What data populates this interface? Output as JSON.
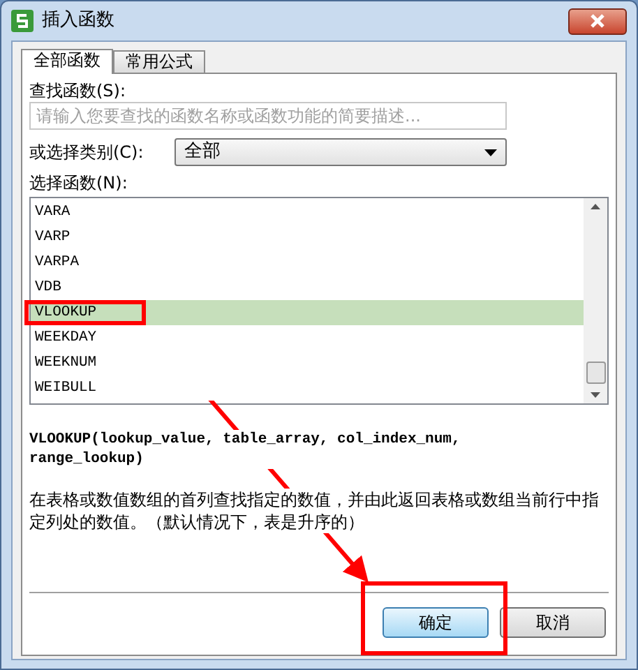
{
  "window": {
    "title": "插入函数"
  },
  "tabs": [
    {
      "label": "全部函数",
      "selected": true
    },
    {
      "label": "常用公式",
      "selected": false
    }
  ],
  "search": {
    "label": "查找函数(S):",
    "placeholder": "请输入您要查找的函数名称或函数功能的简要描述..."
  },
  "category": {
    "label": "或选择类别(C):",
    "value": "全部"
  },
  "functions": {
    "label": "选择函数(N):",
    "items": [
      {
        "name": "VARA",
        "selected": false
      },
      {
        "name": "VARP",
        "selected": false
      },
      {
        "name": "VARPA",
        "selected": false
      },
      {
        "name": "VDB",
        "selected": false
      },
      {
        "name": "VLOOKUP",
        "selected": true
      },
      {
        "name": "WEEKDAY",
        "selected": false
      },
      {
        "name": "WEEKNUM",
        "selected": false
      },
      {
        "name": "WEIBULL",
        "selected": false
      }
    ]
  },
  "signature": "VLOOKUP(lookup_value, table_array, col_index_num, range_lookup)",
  "description": "在表格或数值数组的首列查找指定的数值，并由此返回表格或数组当前行中指定列处的数值。（默认情况下，表是升序的）",
  "buttons": [
    {
      "label": "确定",
      "kind": "primary"
    },
    {
      "label": "取消",
      "kind": "secondary"
    }
  ]
}
